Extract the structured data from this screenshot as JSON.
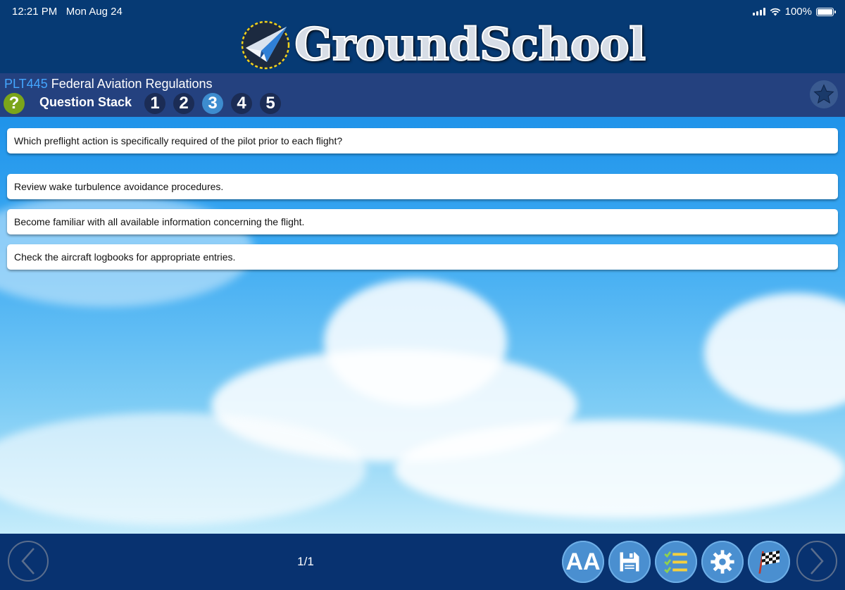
{
  "status_bar": {
    "time": "12:21 PM",
    "date": "Mon Aug 24",
    "battery": "100%"
  },
  "app": {
    "title": "GroundSchool"
  },
  "course": {
    "code": "PLT445",
    "name": "Federal Aviation Regulations"
  },
  "question_stack": {
    "label": "Question Stack",
    "numbers": [
      "1",
      "2",
      "3",
      "4",
      "5"
    ],
    "selected": "3"
  },
  "question": {
    "text": "Which preflight action is specifically required of the pilot prior to each flight?"
  },
  "answers": [
    "Review wake turbulence avoidance procedures.",
    "Become familiar with all available information concerning the flight.",
    "Check the aircraft logbooks for appropriate entries."
  ],
  "footer": {
    "page_counter": "1/1",
    "text_size_label": "AA"
  },
  "colors": {
    "header": "#063a74",
    "sub_header": "#24417f",
    "course_code": "#44a6ff",
    "help": "#7ba51a",
    "active_number": "#3d8ccf",
    "tool_button": "#4a8fd0"
  }
}
